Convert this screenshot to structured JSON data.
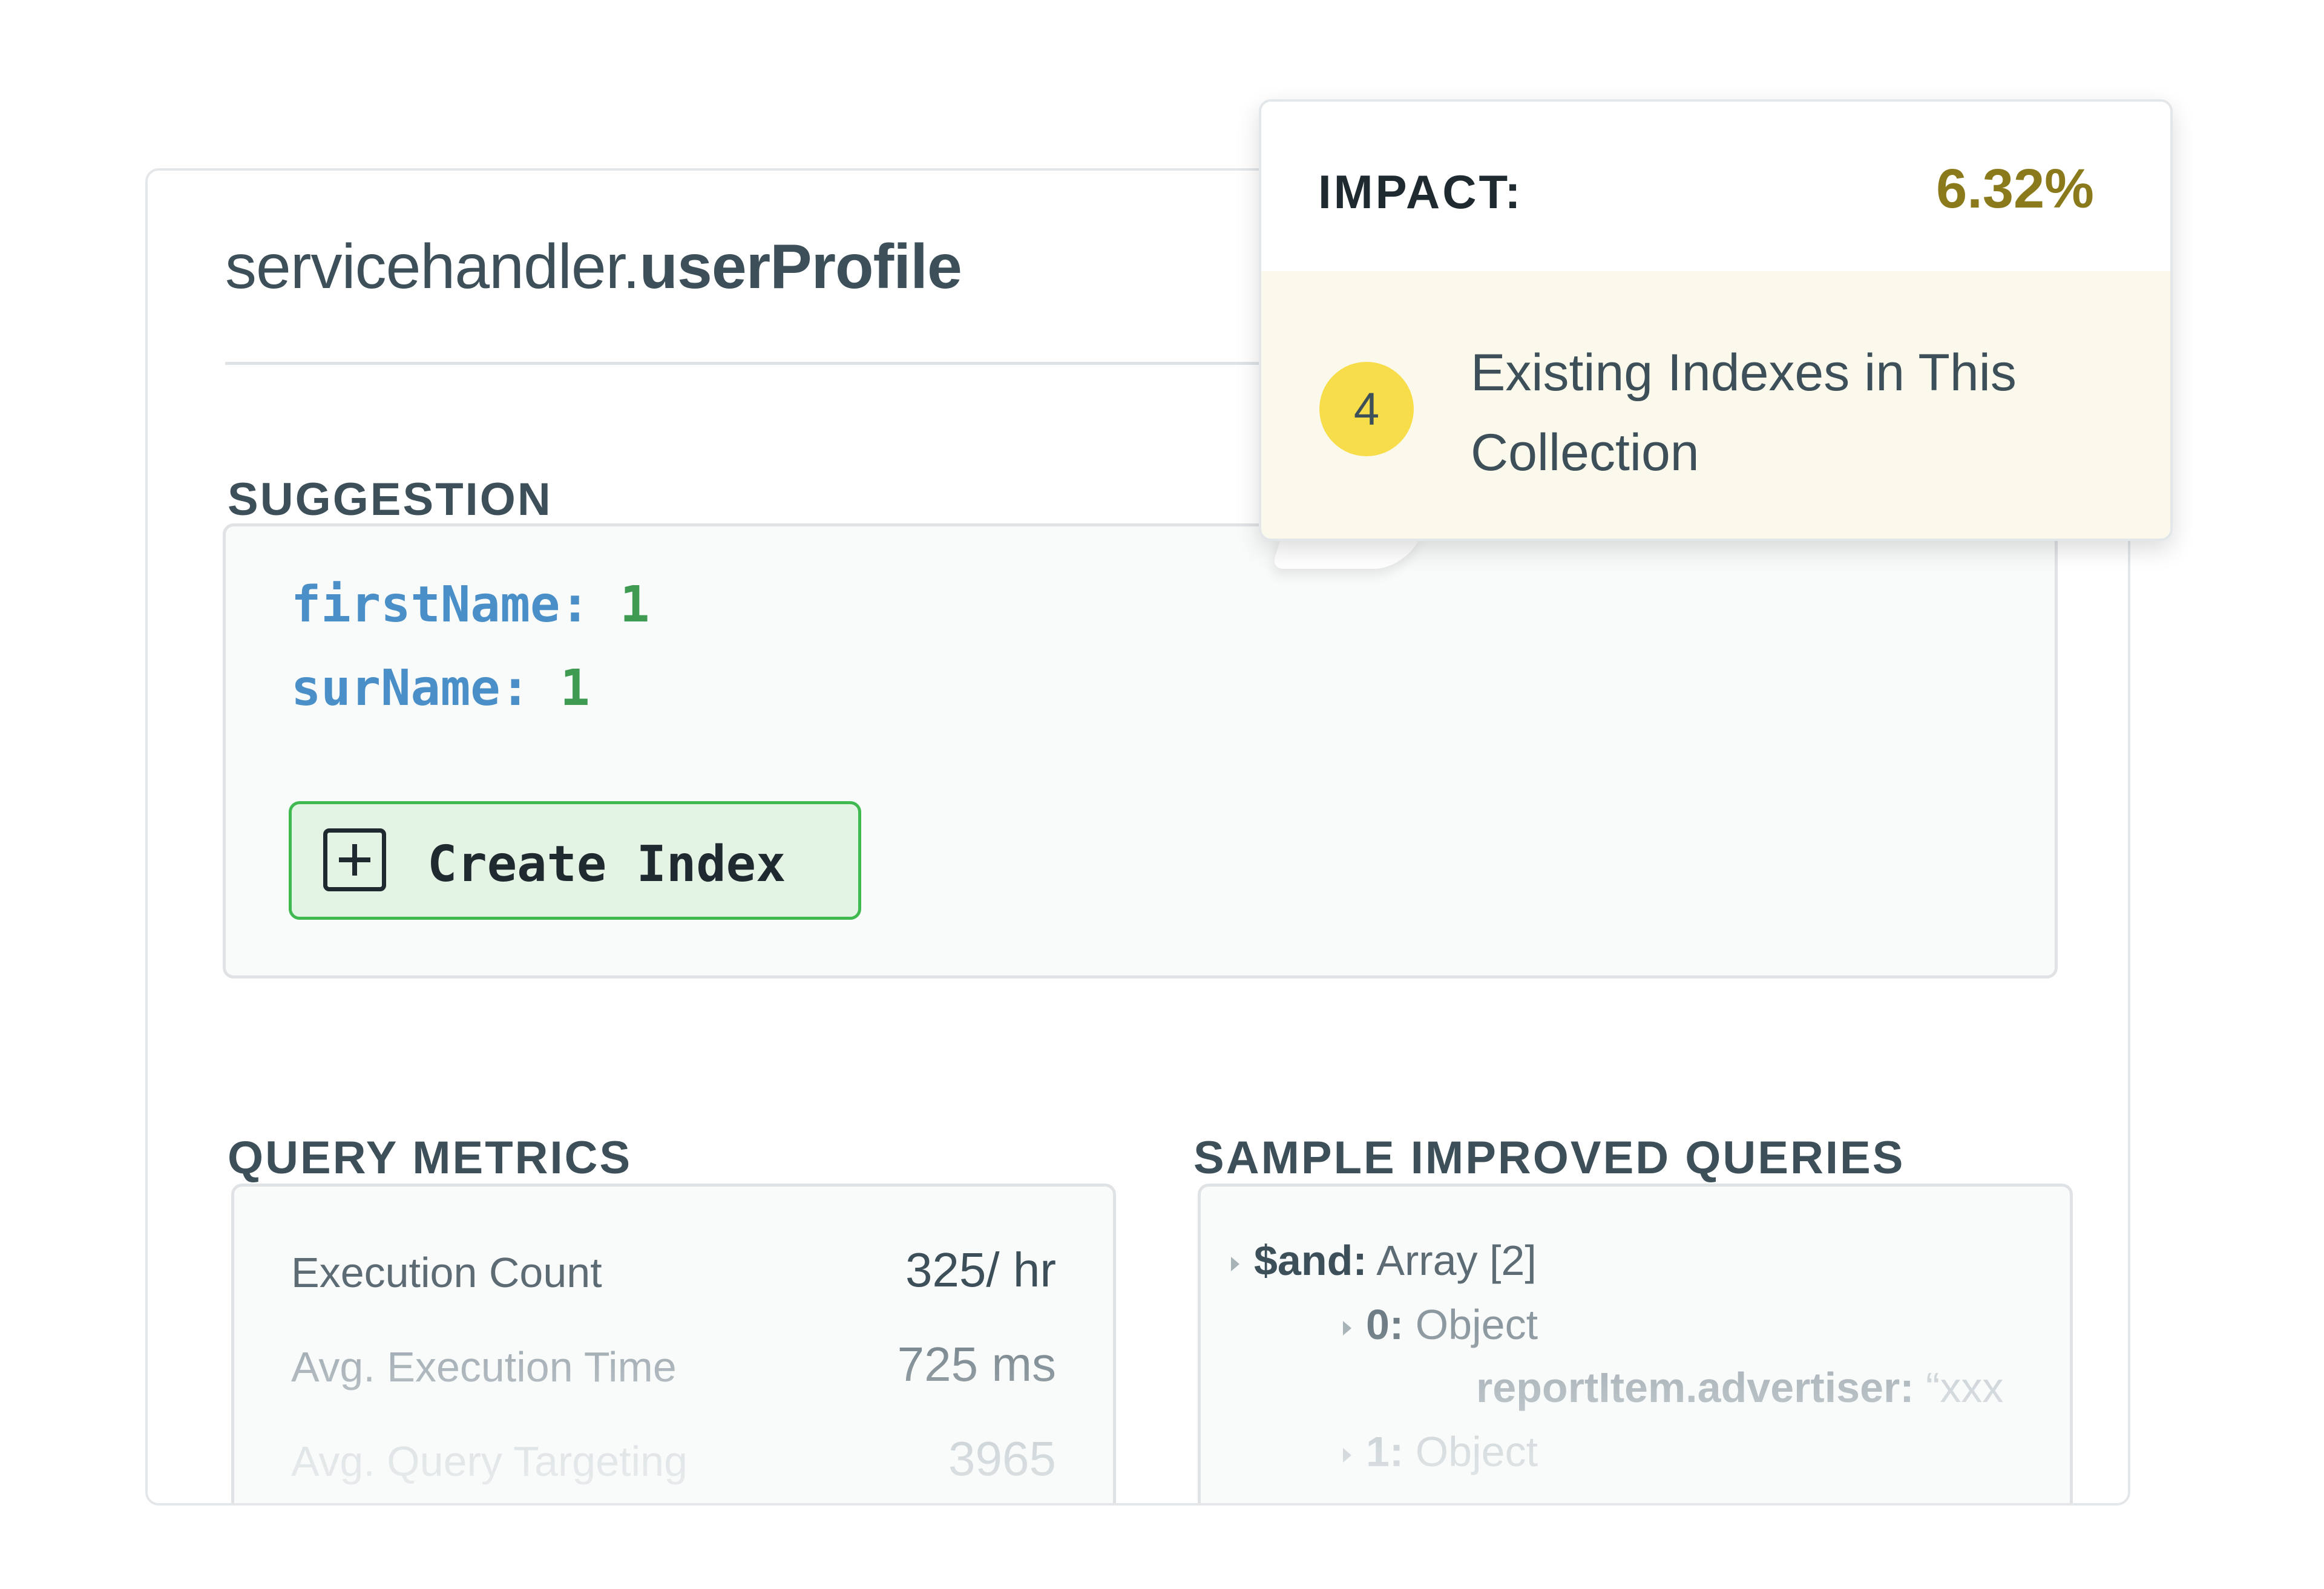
{
  "namespace": {
    "database": "servicehandler.",
    "collection": "userProfile"
  },
  "suggestion": {
    "section_label": "SUGGESTION",
    "index_fields": [
      {
        "key": "firstName:",
        "value": "1"
      },
      {
        "key": "surName:",
        "value": "1"
      }
    ],
    "create_button_label": "Create Index"
  },
  "query_metrics": {
    "section_label": "QUERY METRICS",
    "rows": [
      {
        "label": "Execution Count",
        "value": "325/ hr"
      },
      {
        "label": "Avg. Execution Time",
        "value": "725 ms"
      },
      {
        "label": "Avg. Query Targeting",
        "value": "3965"
      }
    ]
  },
  "sample_queries": {
    "section_label": "SAMPLE IMPROVED QUERIES",
    "lines": [
      {
        "key": "$and:",
        "value": "Array [2]"
      },
      {
        "key": "0:",
        "value": "Object"
      },
      {
        "key": "reportItem.advertiser:",
        "value": "“xxx"
      },
      {
        "key": "1:",
        "value": "Object"
      }
    ]
  },
  "tooltip": {
    "impact_label": "IMPACT:",
    "impact_value": "6.32%",
    "existing_index_count": "4",
    "existing_index_text": "Existing Indexes in This Collection"
  },
  "colors": {
    "accent_green": "#3fb950",
    "impact_gold": "#8a7a1c",
    "badge_yellow": "#f7dd4a",
    "code_key_blue": "#4a8fc7",
    "code_value_green": "#3f9a52"
  }
}
